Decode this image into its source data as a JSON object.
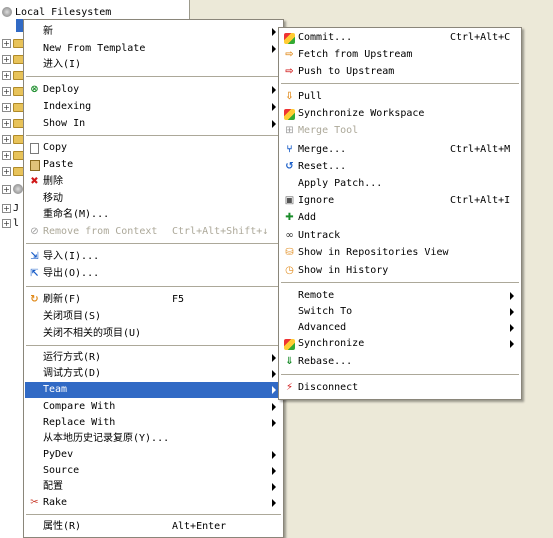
{
  "tree": {
    "root_label": "Local Filesystem",
    "selected_label": "J…",
    "partial_labels": [
      "J",
      "l"
    ]
  },
  "main_menu": {
    "items": [
      {
        "label": "新",
        "arrow": true,
        "icon": ""
      },
      {
        "label": "New From Template",
        "arrow": true,
        "icon": ""
      },
      {
        "label": "进入(I)",
        "arrow": false,
        "icon": ""
      },
      {
        "label": "Deploy",
        "arrow": true,
        "icon": "deploy-icon"
      },
      {
        "label": "Indexing",
        "arrow": true,
        "icon": ""
      },
      {
        "label": "Show In",
        "arrow": true,
        "icon": ""
      },
      {
        "label": "Copy",
        "arrow": false,
        "icon": "copy-icon"
      },
      {
        "label": "Paste",
        "arrow": false,
        "icon": "paste-icon"
      },
      {
        "label": "删除",
        "arrow": false,
        "icon": "delete-icon"
      },
      {
        "label": "移动",
        "arrow": false,
        "icon": ""
      },
      {
        "label": "重命名(M)...",
        "arrow": false,
        "icon": ""
      },
      {
        "label": "Remove from Context",
        "accelerator": "Ctrl+Alt+Shift+↓",
        "disabled": true,
        "icon": "remove-context-icon"
      },
      {
        "label": "导入(I)...",
        "arrow": false,
        "icon": "import-icon"
      },
      {
        "label": "导出(O)...",
        "arrow": false,
        "icon": "export-icon"
      },
      {
        "label": "刷新(F)",
        "accelerator": "F5",
        "icon": "refresh-icon"
      },
      {
        "label": "关闭项目(S)",
        "icon": ""
      },
      {
        "label": "关闭不相关的项目(U)",
        "icon": ""
      },
      {
        "label": "运行方式(R)",
        "arrow": true,
        "icon": ""
      },
      {
        "label": "调试方式(D)",
        "arrow": true,
        "icon": ""
      },
      {
        "label": "Team",
        "arrow": true,
        "highlighted": true,
        "icon": ""
      },
      {
        "label": "Compare With",
        "arrow": true,
        "icon": ""
      },
      {
        "label": "Replace With",
        "arrow": true,
        "icon": ""
      },
      {
        "label": "从本地历史记录复原(Y)...",
        "icon": ""
      },
      {
        "label": "PyDev",
        "arrow": true,
        "icon": ""
      },
      {
        "label": "Source",
        "arrow": true,
        "icon": ""
      },
      {
        "label": "配置",
        "arrow": true,
        "icon": ""
      },
      {
        "label": "Rake",
        "arrow": true,
        "icon": "rake-icon"
      },
      {
        "label": "属性(R)",
        "accelerator": "Alt+Enter",
        "icon": ""
      }
    ]
  },
  "team_menu": {
    "items": [
      {
        "label": "Commit...",
        "accelerator": "Ctrl+Alt+C",
        "icon": "commit-icon"
      },
      {
        "label": "Fetch from Upstream",
        "icon": "fetch-icon"
      },
      {
        "label": "Push to Upstream",
        "icon": "push-icon"
      },
      {
        "label": "Pull",
        "icon": "pull-icon"
      },
      {
        "label": "Synchronize Workspace",
        "icon": "synchronize-icon"
      },
      {
        "label": "Merge Tool",
        "disabled": true,
        "icon": "merge-tool-icon"
      },
      {
        "label": "Merge...",
        "accelerator": "Ctrl+Alt+M",
        "icon": "merge-icon"
      },
      {
        "label": "Reset...",
        "icon": "reset-icon"
      },
      {
        "label": "Apply Patch...",
        "icon": ""
      },
      {
        "label": "Ignore",
        "accelerator": "Ctrl+Alt+I",
        "icon": "ignore-icon"
      },
      {
        "label": "Add",
        "icon": "add-icon"
      },
      {
        "label": "Untrack",
        "icon": "untrack-icon"
      },
      {
        "label": "Show in Repositories View",
        "icon": "repositories-icon"
      },
      {
        "label": "Show in History",
        "icon": "history-icon"
      },
      {
        "label": "Remote",
        "arrow": true,
        "icon": ""
      },
      {
        "label": "Switch To",
        "arrow": true,
        "icon": ""
      },
      {
        "label": "Advanced",
        "arrow": true,
        "icon": ""
      },
      {
        "label": "Synchronize",
        "arrow": true,
        "icon": "synchronize-icon"
      },
      {
        "label": "Rebase...",
        "icon": "rebase-icon"
      },
      {
        "label": "Disconnect",
        "icon": "disconnect-icon"
      }
    ]
  },
  "colors": {
    "highlight": "#316ac5",
    "disabled_text": "#aca899",
    "menu_bg": "#ffffff",
    "desktop_bg": "#ece9d8"
  }
}
